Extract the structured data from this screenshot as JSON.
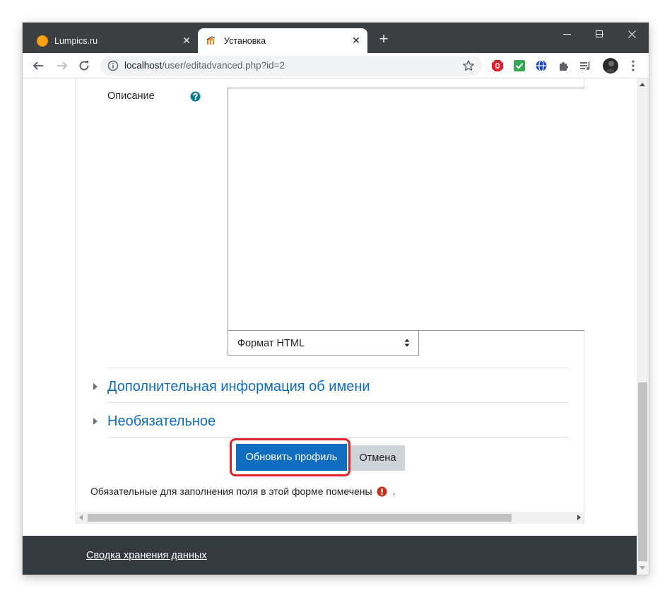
{
  "tabs": [
    {
      "title": "Lumpics.ru",
      "active": false
    },
    {
      "title": "Установка",
      "active": true
    }
  ],
  "omnibox": {
    "host": "localhost",
    "path": "/user/editadvanced.php?id=2"
  },
  "form": {
    "description_label": "Описание",
    "format_select_value": "Формат HTML",
    "sections": [
      {
        "title": "Дополнительная информация об имени"
      },
      {
        "title": "Необязательное"
      }
    ],
    "submit_label": "Обновить профиль",
    "cancel_label": "Отмена",
    "required_note": "Обязательные для заполнения поля в этой форме помечены",
    "required_note_suffix": "."
  },
  "footer": {
    "link": "Сводка хранения данных"
  },
  "colors": {
    "brand_primary": "#0f6cbf",
    "highlight_red": "#e0202a",
    "required_icon": "#ca3120",
    "help_icon": "#0a7e8c",
    "footer_bg": "#353a40"
  }
}
